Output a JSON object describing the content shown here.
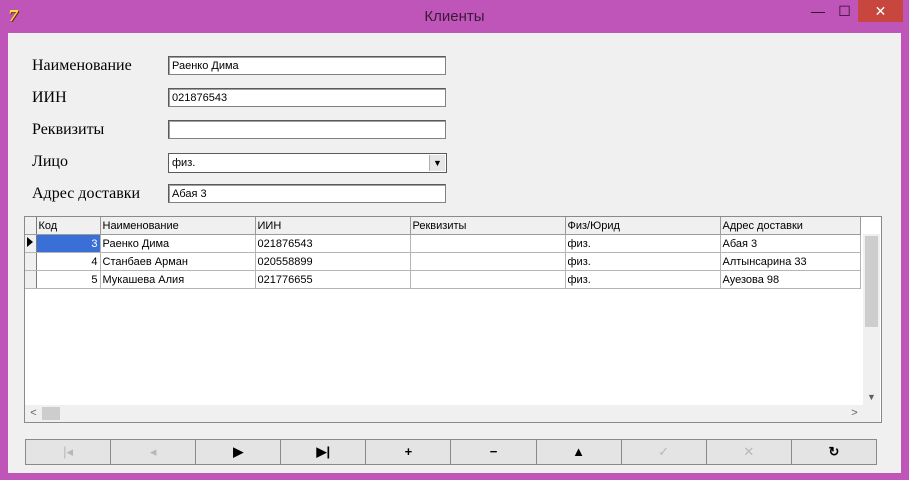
{
  "window": {
    "title": "Клиенты",
    "min": "—",
    "max": "☐",
    "close": "✕",
    "icon": "7"
  },
  "form": {
    "name_label": "Наименование",
    "name_value": "Раенко Дима",
    "iin_label": "ИИН",
    "iin_value": "021876543",
    "req_label": "Реквизиты",
    "req_value": "",
    "face_label": "Лицо",
    "face_value": "физ.",
    "addr_label": "Адрес доставки",
    "addr_value": "Абая 3"
  },
  "table": {
    "headers": [
      "Код",
      "Наименование",
      "ИИН",
      "Реквизиты",
      "Физ/Юрид",
      "Адрес доставки"
    ],
    "rows": [
      {
        "code": "3",
        "name": "Раенко Дима",
        "iin": "021876543",
        "req": "",
        "type": "физ.",
        "addr": "Абая 3"
      },
      {
        "code": "4",
        "name": "Станбаев Арман",
        "iin": "020558899",
        "req": "",
        "type": "физ.",
        "addr": "Алтынсарина 33"
      },
      {
        "code": "5",
        "name": "Мукашева Алия",
        "iin": "021776655",
        "req": "",
        "type": "физ.",
        "addr": "Ауезова 98"
      }
    ]
  },
  "navigator": {
    "first": "|◂",
    "prior": "◂",
    "next": "▶",
    "last": "▶|",
    "insert": "+",
    "delete": "−",
    "edit": "▲",
    "post": "✓",
    "cancel": "✕",
    "refresh": "↻"
  }
}
